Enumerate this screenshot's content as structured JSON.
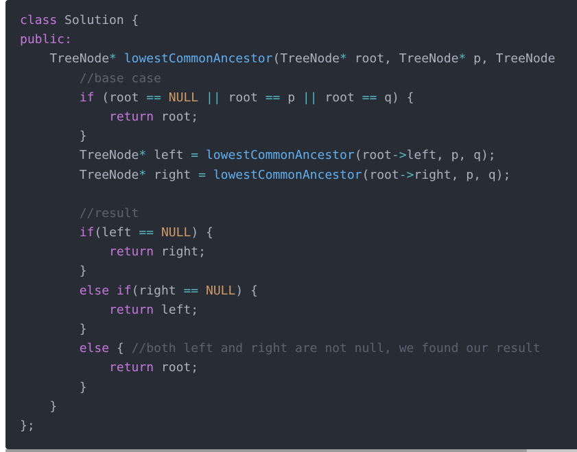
{
  "colors": {
    "background": "#282c34",
    "plain": "#abb2bf",
    "keyword": "#c678dd",
    "function": "#61afef",
    "operator": "#56b6c2",
    "constant": "#d19a66",
    "comment": "#5c6370"
  },
  "code": {
    "lines": [
      [
        {
          "t": "class",
          "k": "keyword"
        },
        {
          "t": " Solution {",
          "k": "plain"
        }
      ],
      [
        {
          "t": "public:",
          "k": "keyword"
        }
      ],
      [
        {
          "t": "    TreeNode",
          "k": "plain"
        },
        {
          "t": "*",
          "k": "operator"
        },
        {
          "t": " ",
          "k": "plain"
        },
        {
          "t": "lowestCommonAncestor",
          "k": "function"
        },
        {
          "t": "(TreeNode",
          "k": "plain"
        },
        {
          "t": "*",
          "k": "operator"
        },
        {
          "t": " root, TreeNode",
          "k": "plain"
        },
        {
          "t": "*",
          "k": "operator"
        },
        {
          "t": " p, TreeNode",
          "k": "plain"
        }
      ],
      [
        {
          "t": "        ",
          "k": "plain"
        },
        {
          "t": "//base case",
          "k": "comment"
        }
      ],
      [
        {
          "t": "        ",
          "k": "plain"
        },
        {
          "t": "if",
          "k": "keyword"
        },
        {
          "t": " (root ",
          "k": "plain"
        },
        {
          "t": "==",
          "k": "operator"
        },
        {
          "t": " ",
          "k": "plain"
        },
        {
          "t": "NULL",
          "k": "constant"
        },
        {
          "t": " ",
          "k": "plain"
        },
        {
          "t": "||",
          "k": "operator"
        },
        {
          "t": " root ",
          "k": "plain"
        },
        {
          "t": "==",
          "k": "operator"
        },
        {
          "t": " p ",
          "k": "plain"
        },
        {
          "t": "||",
          "k": "operator"
        },
        {
          "t": " root ",
          "k": "plain"
        },
        {
          "t": "==",
          "k": "operator"
        },
        {
          "t": " q) {",
          "k": "plain"
        }
      ],
      [
        {
          "t": "            ",
          "k": "plain"
        },
        {
          "t": "return",
          "k": "keyword"
        },
        {
          "t": " root;",
          "k": "plain"
        }
      ],
      [
        {
          "t": "        }",
          "k": "plain"
        }
      ],
      [
        {
          "t": "        TreeNode",
          "k": "plain"
        },
        {
          "t": "*",
          "k": "operator"
        },
        {
          "t": " left ",
          "k": "plain"
        },
        {
          "t": "=",
          "k": "operator"
        },
        {
          "t": " ",
          "k": "plain"
        },
        {
          "t": "lowestCommonAncestor",
          "k": "function"
        },
        {
          "t": "(root",
          "k": "plain"
        },
        {
          "t": "->",
          "k": "operator"
        },
        {
          "t": "left, p, q);",
          "k": "plain"
        }
      ],
      [
        {
          "t": "        TreeNode",
          "k": "plain"
        },
        {
          "t": "*",
          "k": "operator"
        },
        {
          "t": " right ",
          "k": "plain"
        },
        {
          "t": "=",
          "k": "operator"
        },
        {
          "t": " ",
          "k": "plain"
        },
        {
          "t": "lowestCommonAncestor",
          "k": "function"
        },
        {
          "t": "(root",
          "k": "plain"
        },
        {
          "t": "->",
          "k": "operator"
        },
        {
          "t": "right, p, q);",
          "k": "plain"
        }
      ],
      [],
      [
        {
          "t": "        ",
          "k": "plain"
        },
        {
          "t": "//result",
          "k": "comment"
        }
      ],
      [
        {
          "t": "        ",
          "k": "plain"
        },
        {
          "t": "if",
          "k": "keyword"
        },
        {
          "t": "(left ",
          "k": "plain"
        },
        {
          "t": "==",
          "k": "operator"
        },
        {
          "t": " ",
          "k": "plain"
        },
        {
          "t": "NULL",
          "k": "constant"
        },
        {
          "t": ") {",
          "k": "plain"
        }
      ],
      [
        {
          "t": "            ",
          "k": "plain"
        },
        {
          "t": "return",
          "k": "keyword"
        },
        {
          "t": " right;",
          "k": "plain"
        }
      ],
      [
        {
          "t": "        }",
          "k": "plain"
        }
      ],
      [
        {
          "t": "        ",
          "k": "plain"
        },
        {
          "t": "else",
          "k": "keyword"
        },
        {
          "t": " ",
          "k": "plain"
        },
        {
          "t": "if",
          "k": "keyword"
        },
        {
          "t": "(right ",
          "k": "plain"
        },
        {
          "t": "==",
          "k": "operator"
        },
        {
          "t": " ",
          "k": "plain"
        },
        {
          "t": "NULL",
          "k": "constant"
        },
        {
          "t": ") {",
          "k": "plain"
        }
      ],
      [
        {
          "t": "            ",
          "k": "plain"
        },
        {
          "t": "return",
          "k": "keyword"
        },
        {
          "t": " left;",
          "k": "plain"
        }
      ],
      [
        {
          "t": "        }",
          "k": "plain"
        }
      ],
      [
        {
          "t": "        ",
          "k": "plain"
        },
        {
          "t": "else",
          "k": "keyword"
        },
        {
          "t": " { ",
          "k": "plain"
        },
        {
          "t": "//both left and right are not null, we found our result",
          "k": "comment"
        }
      ],
      [
        {
          "t": "            ",
          "k": "plain"
        },
        {
          "t": "return",
          "k": "keyword"
        },
        {
          "t": " root;",
          "k": "plain"
        }
      ],
      [
        {
          "t": "        }",
          "k": "plain"
        }
      ],
      [
        {
          "t": "    }",
          "k": "plain"
        }
      ],
      [
        {
          "t": "};",
          "k": "plain"
        }
      ]
    ]
  }
}
